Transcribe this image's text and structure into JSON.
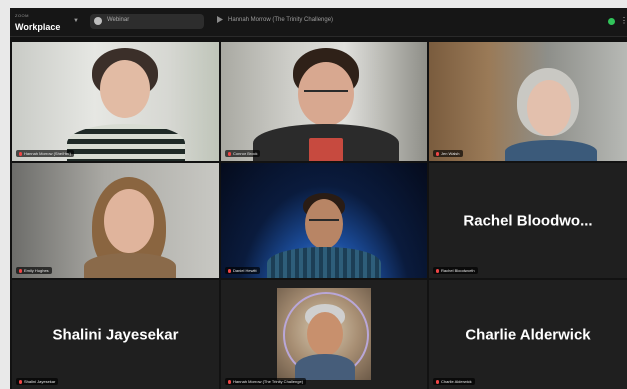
{
  "topbar": {
    "brand_small": "ZOOM",
    "brand": "Workplace",
    "search_placeholder": "Webinar",
    "meeting_title": "Hannah Morrow (The Trinity Challenge)"
  },
  "participants": [
    {
      "id": "p1",
      "tag": "Hannah Morrow (She/Her)",
      "kind": "video"
    },
    {
      "id": "p2",
      "tag": "Connor Brock",
      "kind": "video"
    },
    {
      "id": "p3",
      "tag": "Jen Walsh",
      "kind": "video"
    },
    {
      "id": "p4",
      "tag": "Emily Hughes",
      "kind": "video"
    },
    {
      "id": "p5",
      "tag": "Daniel Hewitt",
      "kind": "video"
    },
    {
      "id": "p6",
      "tag": "Rachel Bloodworth",
      "kind": "name",
      "display": "Rachel  Bloodwo..."
    },
    {
      "id": "p7",
      "tag": "Shalini Jayesekar",
      "kind": "name",
      "display": "Shalini Jayesekar"
    },
    {
      "id": "p8",
      "tag": "Hannah Morrow (The Trinity Challenge)",
      "kind": "photo"
    },
    {
      "id": "p9",
      "tag": "Charlie Alderwick",
      "kind": "name",
      "display": "Charlie Alderwick"
    }
  ],
  "colors": {
    "active_speaker": "#5ad18f",
    "muted": "#f04646",
    "online": "#31c45a"
  }
}
